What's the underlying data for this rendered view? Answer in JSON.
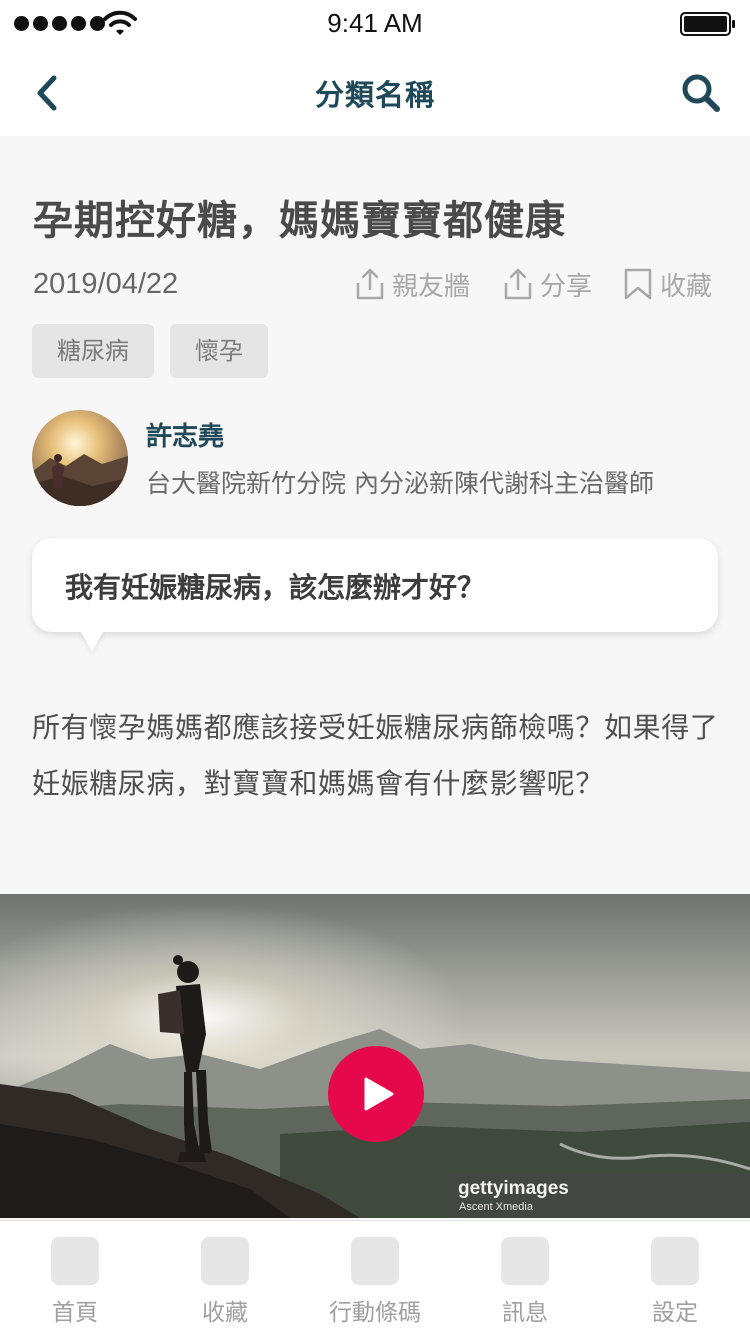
{
  "status_bar": {
    "time": "9:41 AM"
  },
  "nav": {
    "title": "分類名稱"
  },
  "article": {
    "title": "孕期控好糖，媽媽寶寶都健康",
    "date": "2019/04/22",
    "actions": [
      {
        "label": "親友牆",
        "icon": "share-upload-icon"
      },
      {
        "label": "分享",
        "icon": "share-upload-icon"
      },
      {
        "label": "收藏",
        "icon": "bookmark-icon"
      }
    ],
    "tags": [
      "糖尿病",
      "懷孕"
    ],
    "author": {
      "name": "許志堯",
      "title": "台大醫院新竹分院 內分泌新陳代謝科主治醫師"
    },
    "question": "我有妊娠糖尿病，該怎麼辦才好？",
    "body": "所有懷孕媽媽都應該接受妊娠糖尿病篩檢嗎？如果得了妊娠糖尿病，對寶寶和媽媽會有什麼影響呢？"
  },
  "video": {
    "watermark_brand": "gettyimages",
    "watermark_credit": "Ascent Xmedia"
  },
  "tab_bar": {
    "items": [
      {
        "label": "首頁"
      },
      {
        "label": "收藏"
      },
      {
        "label": "行動條碼"
      },
      {
        "label": "訊息"
      },
      {
        "label": "設定"
      }
    ]
  },
  "colors": {
    "primary": "#1f4958",
    "play_button": "#e6084d",
    "tag_background": "#e5e5e5",
    "page_background": "#f7f7f7"
  }
}
